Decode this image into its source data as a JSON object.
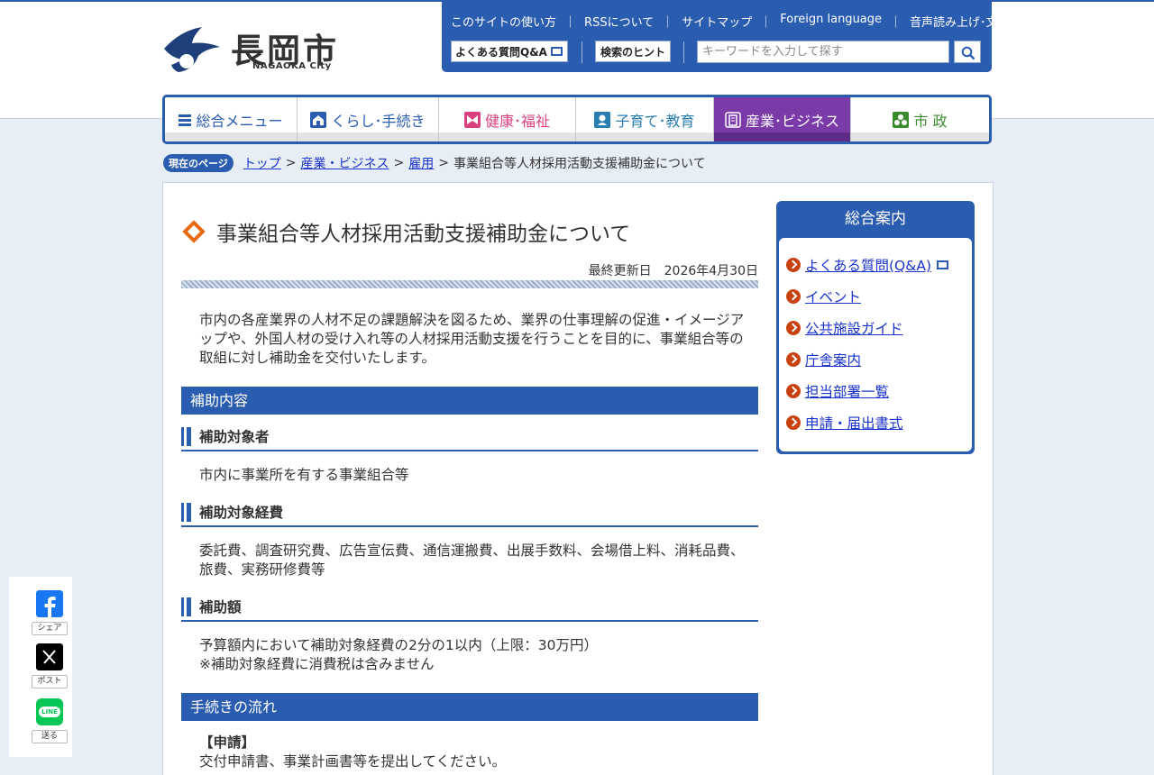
{
  "logo": {
    "name": "長岡市",
    "sub": "NAGAOKA City"
  },
  "utility": {
    "links": [
      "このサイトの使い方",
      "RSSについて",
      "サイトマップ",
      "Foreign language",
      "音声読み上げ･文字拡大等"
    ],
    "separator": "｜",
    "faq_label": "よくある質問Q&A",
    "hint_label": "検索のヒント",
    "search_placeholder": "キーワードを入力して探す"
  },
  "gnav": {
    "items": [
      {
        "label": "総合メニュー"
      },
      {
        "label": "くらし･手続き"
      },
      {
        "label": "健康･福祉"
      },
      {
        "label": "子育て･教育"
      },
      {
        "label": "産業･ビジネス"
      },
      {
        "label": "市 政"
      }
    ]
  },
  "breadcrumb": {
    "tag": "現在のページ",
    "items": [
      "トップ",
      "産業・ビジネス",
      "雇用"
    ],
    "separator": ">",
    "current": "事業組合等人材採用活動支援補助金について"
  },
  "page": {
    "title": "事業組合等人材採用活動支援補助金について",
    "updated_label": "最終更新日",
    "updated_date": "2026年4月30日",
    "intro": "市内の各産業界の人材不足の課題解決を図るため、業界の仕事理解の促進・イメージアップや、外国人材の受け入れ等の人材採用活動支援を行うことを目的に、事業組合等の取組に対し補助金を交付いたします。",
    "section1": "補助内容",
    "target_heading": "補助対象者",
    "target_text": "市内に事業所を有する事業組合等",
    "cost_heading": "補助対象経費",
    "cost_text": "委託費、調査研究費、広告宣伝費、通信運搬費、出展手数料、会場借上料、消耗品費、旅費、実務研修費等",
    "amount_heading": "補助額",
    "amount_line1": "予算額内において補助対象経費の2分の1以内（上限：30万円）",
    "amount_line2": "※補助対象経費に消費税は含みません",
    "section2": "手続きの流れ",
    "apply_heading": "【申請】",
    "apply_text": "交付申請書、事業計画書等を提出してください。"
  },
  "sidebar": {
    "title": "総合案内",
    "links": [
      "よくある質問(Q&A)",
      "イベント",
      "公共施設ガイド",
      "庁舎案内",
      "担当部署一覧",
      "申請・届出書式"
    ]
  },
  "share": {
    "facebook_label": "シェア",
    "x_label": "ポスト",
    "line_label": "送る",
    "line_icon_text": "LINE"
  },
  "colors": {
    "primary": "#2a5db0",
    "accent": "#e86a10",
    "business": "#7a3aa8",
    "link": "#1a33cc"
  }
}
